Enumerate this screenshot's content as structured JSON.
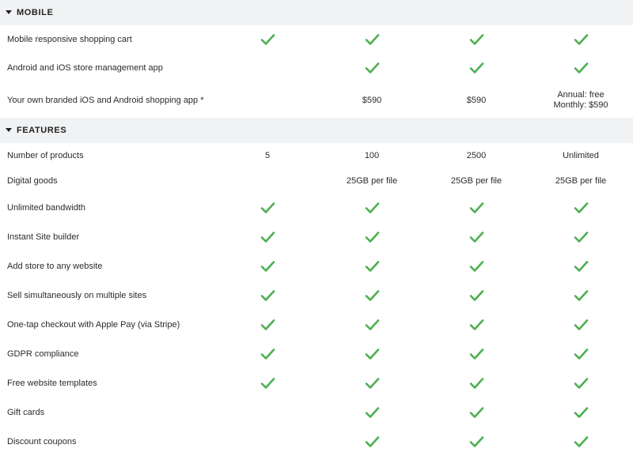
{
  "sections": [
    {
      "title": "MOBILE",
      "rows": [
        {
          "label": "Mobile responsive shopping cart",
          "cells": [
            "check",
            "check",
            "check",
            "check"
          ]
        },
        {
          "label": "Android and iOS store management app",
          "cells": [
            "",
            "check",
            "check",
            "check"
          ]
        },
        {
          "label": "Your own branded iOS and Android shopping app *",
          "cells": [
            "",
            "$590",
            "$590",
            "Annual: free|Monthly: $590"
          ]
        }
      ]
    },
    {
      "title": "FEATURES",
      "rows": [
        {
          "label": "Number of products",
          "cells": [
            "5",
            "100",
            "2500",
            "Unlimited"
          ]
        },
        {
          "label": "Digital goods",
          "cells": [
            "",
            "25GB per file",
            "25GB per file",
            "25GB per file"
          ]
        },
        {
          "label": "Unlimited bandwidth",
          "cells": [
            "check",
            "check",
            "check",
            "check"
          ]
        },
        {
          "label": "Instant Site builder",
          "cells": [
            "check",
            "check",
            "check",
            "check"
          ]
        },
        {
          "label": "Add store to any website",
          "cells": [
            "check",
            "check",
            "check",
            "check"
          ]
        },
        {
          "label": "Sell simultaneously on multiple sites",
          "cells": [
            "check",
            "check",
            "check",
            "check"
          ]
        },
        {
          "label": "One-tap checkout with Apple Pay (via Stripe)",
          "cells": [
            "check",
            "check",
            "check",
            "check"
          ]
        },
        {
          "label": "GDPR compliance",
          "cells": [
            "check",
            "check",
            "check",
            "check"
          ]
        },
        {
          "label": "Free website templates",
          "cells": [
            "check",
            "check",
            "check",
            "check"
          ]
        },
        {
          "label": "Gift cards",
          "cells": [
            "",
            "check",
            "check",
            "check"
          ]
        },
        {
          "label": "Discount coupons",
          "cells": [
            "",
            "check",
            "check",
            "check"
          ]
        }
      ]
    }
  ],
  "icons": {
    "check": "check-icon",
    "section_toggle": "caret-down-icon"
  },
  "colors": {
    "check": "#4caf50",
    "header_bg": "#f1f2f3"
  }
}
